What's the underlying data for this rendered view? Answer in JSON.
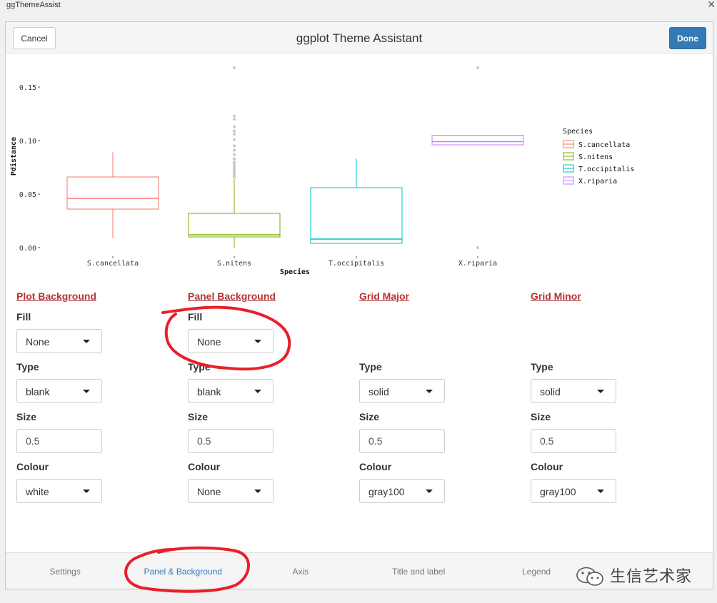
{
  "window": {
    "title": "ggThemeAssist",
    "close_glyph": "✕"
  },
  "header": {
    "cancel_label": "Cancel",
    "title": "ggplot Theme Assistant",
    "done_label": "Done"
  },
  "chart_data": {
    "type": "boxplot",
    "xlabel": "Species",
    "ylabel": "Pdistance",
    "ylim": [
      0.0,
      0.17
    ],
    "yticks": [
      "0.00",
      "0.05",
      "0.10",
      "0.15"
    ],
    "ytick_values": [
      0.0,
      0.05,
      0.1,
      0.15
    ],
    "categories": [
      "S.cancellata",
      "S.nitens",
      "T.occipitalis",
      "X.riparia"
    ],
    "legend": {
      "title": "Species",
      "position": "right",
      "entries": [
        "S.cancellata",
        "S.nitens",
        "T.occipitalis",
        "X.riparia"
      ]
    },
    "colors": [
      "#f8766d",
      "#7cae00",
      "#00bfc4",
      "#c77cff"
    ],
    "boxes": [
      {
        "category": "S.cancellata",
        "whisker_low": 0.009,
        "q1": 0.036,
        "median": 0.046,
        "q3": 0.066,
        "whisker_high": 0.089,
        "outliers": []
      },
      {
        "category": "S.nitens",
        "whisker_low": 0.0,
        "q1": 0.01,
        "median": 0.012,
        "q3": 0.032,
        "whisker_high": 0.064,
        "outliers": [
          0.066,
          0.068,
          0.07,
          0.072,
          0.074,
          0.076,
          0.078,
          0.08,
          0.083,
          0.087,
          0.091,
          0.095,
          0.101,
          0.106,
          0.109,
          0.113,
          0.12,
          0.123,
          0.168
        ]
      },
      {
        "category": "T.occipitalis",
        "whisker_low": 0.004,
        "q1": 0.004,
        "median": 0.008,
        "q3": 0.056,
        "whisker_high": 0.083,
        "outliers": []
      },
      {
        "category": "X.riparia",
        "whisker_low": 0.096,
        "q1": 0.096,
        "median": 0.099,
        "q3": 0.105,
        "whisker_high": 0.105,
        "outliers": [
          0.0,
          0.168
        ]
      }
    ]
  },
  "sections": [
    {
      "title": "Plot Background",
      "fields": [
        {
          "label": "Fill",
          "kind": "select",
          "value": "None"
        },
        {
          "label": "Type",
          "kind": "select",
          "value": "blank"
        },
        {
          "label": "Size",
          "kind": "input",
          "value": "0.5"
        },
        {
          "label": "Colour",
          "kind": "select",
          "value": "white"
        }
      ]
    },
    {
      "title": "Panel Background",
      "fields": [
        {
          "label": "Fill",
          "kind": "select",
          "value": "None"
        },
        {
          "label": "Type",
          "kind": "select",
          "value": "blank"
        },
        {
          "label": "Size",
          "kind": "input",
          "value": "0.5"
        },
        {
          "label": "Colour",
          "kind": "select",
          "value": "None"
        }
      ]
    },
    {
      "title": "Grid Major",
      "fields": [
        {
          "label": "Type",
          "kind": "select",
          "value": "solid"
        },
        {
          "label": "Size",
          "kind": "input",
          "value": "0.5"
        },
        {
          "label": "Colour",
          "kind": "select",
          "value": "gray100"
        }
      ]
    },
    {
      "title": "Grid Minor",
      "fields": [
        {
          "label": "Type",
          "kind": "select",
          "value": "solid"
        },
        {
          "label": "Size",
          "kind": "input",
          "value": "0.5"
        },
        {
          "label": "Colour",
          "kind": "select",
          "value": "gray100"
        }
      ]
    }
  ],
  "tabs": [
    {
      "label": "Settings",
      "active": false
    },
    {
      "label": "Panel & Background",
      "active": true
    },
    {
      "label": "Axis",
      "active": false
    },
    {
      "label": "Title and label",
      "active": false
    },
    {
      "label": "Legend",
      "active": false
    }
  ],
  "watermark": {
    "text": "生信艺术家"
  },
  "colors": {
    "accent": "#337ab7",
    "section_title": "#b33434",
    "annotation": "#e8202a"
  }
}
